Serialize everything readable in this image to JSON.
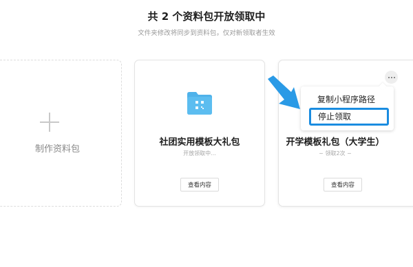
{
  "header": {
    "title": "共 2 个资料包开放领取中",
    "subtitle": "文件夹修改将同步到资料包，仅对新领取者生效"
  },
  "create_card": {
    "label": "制作资料包"
  },
  "packs": [
    {
      "name": "社团实用模板大礼包",
      "status": "开放领取中...",
      "view_button": "查看内容",
      "icon": "folder-qr-icon"
    },
    {
      "name": "开学模板礼包（大学生）",
      "status": "~ 领取2次 ~",
      "view_button": "查看内容"
    }
  ],
  "dropdown_menu": {
    "items": [
      "复制小程序路径",
      "停止领取"
    ],
    "highlighted": "停止领取"
  },
  "colors": {
    "accent": "#1a8ce0",
    "folder": "#4fb2ea",
    "arrow": "#2a9ae6"
  }
}
